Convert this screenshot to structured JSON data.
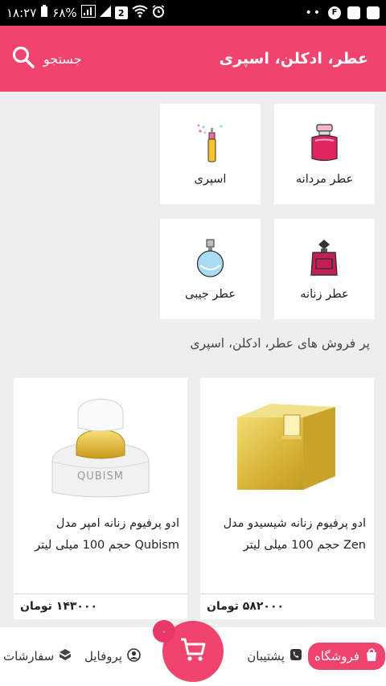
{
  "status_bar": {
    "time": "۱۸:۲۷",
    "battery": "۶۸%",
    "notification_count": "2",
    "badge_letter": "F",
    "dots": "••"
  },
  "app_bar": {
    "title": "عطر، ادکلن، اسپری",
    "search_label": "جستجو",
    "icon": "search-icon"
  },
  "categories": [
    {
      "label": "عطر مردانه",
      "icon": "mens-perfume-icon"
    },
    {
      "label": "اسپری",
      "icon": "spray-icon"
    },
    {
      "label": "عطر زنانه",
      "icon": "womens-perfume-icon"
    },
    {
      "label": "عطر جیبی",
      "icon": "pocket-perfume-icon"
    }
  ],
  "section": {
    "title": "پر فروش های عطر، ادکلن، اسپری"
  },
  "products": [
    {
      "name": "ادو پرفیوم زنانه شیسیدو مدل Zen حجم 100 میلی لیتر",
      "price": "۵۸۲۰۰۰ تومان"
    },
    {
      "name": "ادو پرفیوم زنانه امپر مدل Qubism حجم 100 میلی لیتر",
      "price": "۱۴۳۰۰۰ تومان"
    }
  ],
  "bottom_nav": {
    "store": "فروشگاه",
    "support": "پشتیبان",
    "profile": "پروفایل",
    "orders": "سفارشات",
    "cart_badge": "۰"
  },
  "colors": {
    "accent": "#f0436e",
    "background": "#eeeeee"
  }
}
